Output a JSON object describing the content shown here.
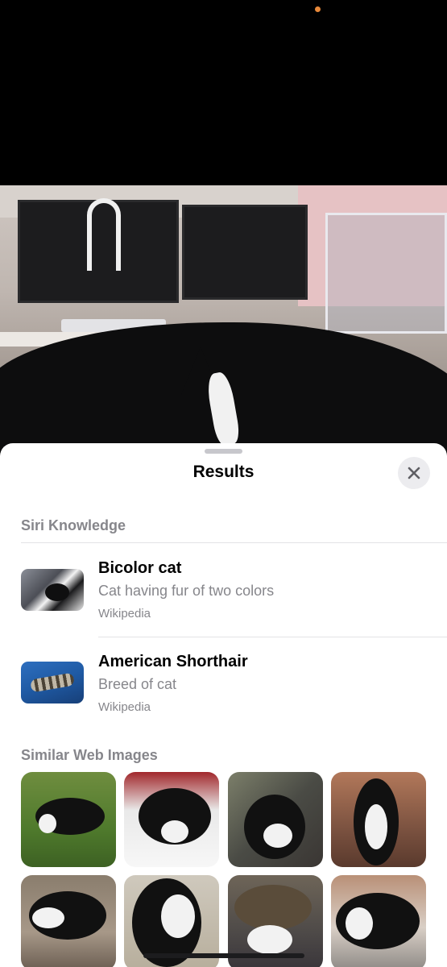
{
  "sheet": {
    "title": "Results",
    "close_icon": "close-icon"
  },
  "siri_knowledge": {
    "label": "Siri Knowledge",
    "results": [
      {
        "title": "Bicolor cat",
        "description": "Cat having fur of two colors",
        "source": "Wikipedia"
      },
      {
        "title": "American Shorthair",
        "description": "Breed of cat",
        "source": "Wikipedia"
      }
    ]
  },
  "similar_web_images": {
    "label": "Similar Web Images",
    "count": 8
  }
}
